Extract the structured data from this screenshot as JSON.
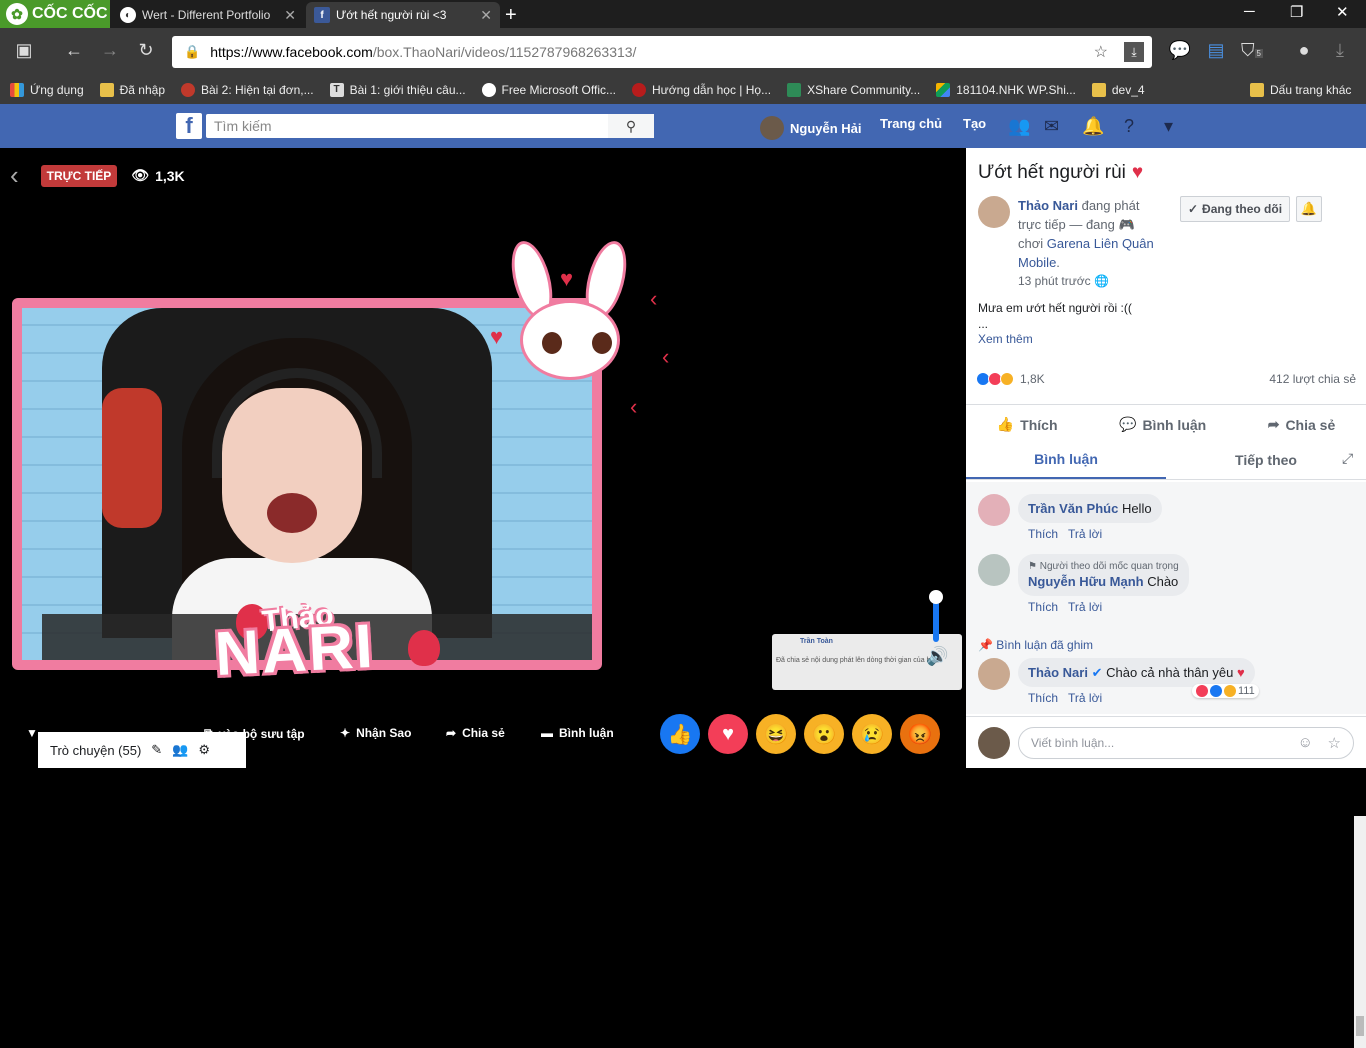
{
  "browser": {
    "brand": "CỐC CỐC",
    "tabs": [
      {
        "title": "Wert - Different Portfolio I"
      },
      {
        "title": "Ướt hết người rùi <3"
      }
    ],
    "url": {
      "host": "https://www.facebook.com",
      "path": "/box.ThaoNari/videos/1152787968263313/"
    },
    "bookmarks": [
      "Ứng dụng",
      "Đã nhập",
      "Bài 2: Hiện tại đơn,...",
      "Bài 1: giới thiệu câu...",
      "Free Microsoft Offic...",
      "Hướng dẫn học | Họ...",
      "XShare Community...",
      "181104.NHK WP.Shi...",
      "dev_4",
      "Dấu trang khác"
    ],
    "ext_badge": "5"
  },
  "fb": {
    "search_placeholder": "Tìm kiếm",
    "user": "Nguyễn Hải",
    "home": "Trang chủ",
    "create": "Tạo"
  },
  "video": {
    "live_label": "TRỰC TIẾP",
    "viewers": "1,3K",
    "overlay_top": "Thảo",
    "overlay_bottom": "NARI",
    "mini_name": "Trần Toàn",
    "mini_text": "Đã chia sẻ nội dung phát lên dòng thời gian của họ",
    "actions": {
      "collection": "vào bộ sưu tập",
      "stars": "Nhận Sao",
      "share": "Chia sẻ",
      "comment": "Bình luận"
    },
    "chat_label": "Trò chuyện (55)"
  },
  "panel": {
    "title": "Ướt hết người rùi",
    "streamer": "Thảo Nari",
    "status_prefix": "đang phát trực tiếp — đang",
    "status_mid": "chơi",
    "game": "Garena Liên Quân Mobile",
    "time": "13 phút trước",
    "follow_label": "Đang theo dõi",
    "description": "Mưa em ướt hết người rồi :((",
    "ellipsis": "...",
    "see_more": "Xem thêm",
    "reaction_count": "1,8K",
    "share_count": "412 lượt chia sẻ",
    "actions": {
      "like": "Thích",
      "comment": "Bình luận",
      "share": "Chia sẻ"
    },
    "tabs": {
      "comments": "Bình luận",
      "next": "Tiếp theo"
    },
    "comments": [
      {
        "name": "Trần Văn Phúc",
        "text": "Hello"
      },
      {
        "badge": "Người theo dõi mốc quan trọng",
        "name": "Nguyễn Hữu Mạnh",
        "text": "Chào"
      }
    ],
    "pinned_label": "Bình luận đã ghim",
    "pinned": {
      "name": "Thảo Nari",
      "text": "Chào cả nhà thân yêu",
      "reactions": "111"
    },
    "comment_actions": {
      "like": "Thích",
      "reply": "Trả lời"
    },
    "compose_placeholder": "Viết bình luận..."
  },
  "colors": {
    "fb_blue": "#4267b2",
    "live_red": "#c23a3a",
    "frame_pink": "#f07ca0"
  }
}
